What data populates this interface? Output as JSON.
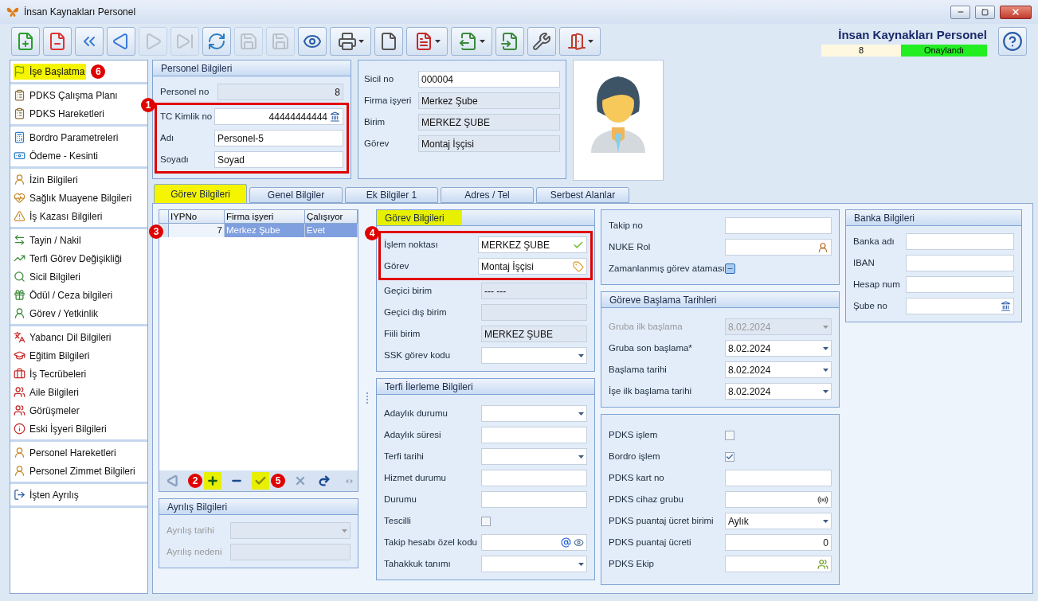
{
  "window": {
    "title": "İnsan Kaynakları Personel"
  },
  "toolbar": [
    {
      "kind": "new",
      "disabled": false,
      "menu": false
    },
    {
      "kind": "delete",
      "disabled": false,
      "menu": false
    },
    {
      "kind": "first",
      "disabled": false,
      "menu": false
    },
    {
      "kind": "prev",
      "disabled": false,
      "menu": false
    },
    {
      "kind": "next",
      "disabled": true,
      "menu": false
    },
    {
      "kind": "last",
      "disabled": true,
      "menu": false
    },
    {
      "kind": "refresh",
      "disabled": false,
      "menu": false
    },
    {
      "kind": "save",
      "disabled": true,
      "menu": false
    },
    {
      "kind": "discard",
      "disabled": true,
      "menu": false
    },
    {
      "kind": "preview",
      "disabled": false,
      "menu": false
    },
    {
      "kind": "print",
      "disabled": false,
      "menu": true
    },
    {
      "kind": "attach",
      "disabled": false,
      "menu": false
    },
    {
      "kind": "pdf",
      "disabled": false,
      "menu": true
    },
    {
      "kind": "export",
      "disabled": false,
      "menu": true
    },
    {
      "kind": "import",
      "disabled": false,
      "menu": false
    },
    {
      "kind": "tools",
      "disabled": false,
      "menu": false
    },
    {
      "kind": "exit",
      "disabled": false,
      "menu": true
    }
  ],
  "header": {
    "title": "İnsan Kaynakları Personel",
    "record_no": "8",
    "status": "Onaylandı"
  },
  "sidebar": {
    "groups": [
      [
        {
          "label": "İşe Başlatma",
          "highlighted": true,
          "badge": "6"
        }
      ],
      [
        {
          "label": "PDKS Çalışma Planı",
          "highlighted": false
        },
        {
          "label": "PDKS Hareketleri",
          "highlighted": false
        }
      ],
      [
        {
          "label": "Bordro Parametreleri",
          "highlighted": false
        },
        {
          "label": "Ödeme - Kesinti",
          "highlighted": false
        }
      ],
      [
        {
          "label": "İzin Bilgileri",
          "highlighted": false
        },
        {
          "label": "Sağlık Muayene Bilgileri",
          "highlighted": false
        },
        {
          "label": "İş Kazası Bilgileri",
          "highlighted": false
        }
      ],
      [
        {
          "label": "Tayin / Nakil",
          "highlighted": false
        },
        {
          "label": "Terfi Görev Değişikliği",
          "highlighted": false
        },
        {
          "label": "Sicil Bilgileri",
          "highlighted": false
        },
        {
          "label": "Ödül / Ceza bilgileri",
          "highlighted": false
        },
        {
          "label": "Görev / Yetkinlik",
          "highlighted": false
        }
      ],
      [
        {
          "label": "Yabancı Dil Bilgileri",
          "highlighted": false
        },
        {
          "label": "Eğitim Bilgileri",
          "highlighted": false
        },
        {
          "label": "İş Tecrübeleri",
          "highlighted": false
        },
        {
          "label": "Aile Bilgileri",
          "highlighted": false
        },
        {
          "label": "Görüşmeler",
          "highlighted": false
        },
        {
          "label": "Eski İşyeri Bilgileri",
          "highlighted": false
        }
      ],
      [
        {
          "label": "Personel Hareketleri",
          "highlighted": false
        },
        {
          "label": "Personel Zimmet Bilgileri",
          "highlighted": false
        }
      ],
      [
        {
          "label": "İşten Ayrılış",
          "highlighted": false
        }
      ]
    ]
  },
  "personnel": {
    "title": "Personel Bilgileri",
    "badge": "1",
    "groups": [
      {
        "framed": false,
        "fields": [
          {
            "label": "Personel no",
            "value": "8",
            "kind": "counter"
          }
        ]
      },
      {
        "framed": true,
        "fields": [
          {
            "label": "TC Kimlik no",
            "value": "44444444444",
            "kind": "bank"
          },
          {
            "label": "Adı",
            "value": "Personel-5",
            "kind": "text"
          },
          {
            "label": "Soyadı",
            "value": "Soyad",
            "kind": "text"
          }
        ]
      }
    ]
  },
  "registry": {
    "fields": [
      {
        "label": "Sicil no",
        "value": "000004",
        "kind": "text"
      },
      {
        "label": "Firma işyeri",
        "value": "Merkez Şube",
        "kind": "readonly"
      },
      {
        "label": "Birim",
        "value": "MERKEZ ŞUBE",
        "kind": "readonly"
      },
      {
        "label": "Görev",
        "value": "Montaj İşçisi",
        "kind": "readonly"
      }
    ]
  },
  "tabs": [
    {
      "label": "Görev Bilgileri",
      "selected": true,
      "highlighted": true
    },
    {
      "label": "Genel Bilgiler",
      "selected": false,
      "highlighted": false
    },
    {
      "label": "Ek Bilgiler 1",
      "selected": false,
      "highlighted": false
    },
    {
      "label": "Adres / Tel",
      "selected": false,
      "highlighted": false
    },
    {
      "label": "Serbest Alanlar",
      "selected": false,
      "highlighted": false
    }
  ],
  "grid": {
    "badge": "3",
    "columns": [
      "IYPNo",
      "Firma işyeri",
      "Çalışıyor"
    ],
    "rows": [
      {
        "cells": [
          "7",
          "Merkez Şube",
          "Evet"
        ],
        "selected": true
      }
    ],
    "navigator": [
      {
        "kind": "prev",
        "highlighted": false
      },
      {
        "kind": "add",
        "highlighted": true,
        "badge": "2"
      },
      {
        "kind": "remove",
        "highlighted": false
      },
      {
        "kind": "confirm",
        "highlighted": true,
        "badge": "5"
      },
      {
        "kind": "cancel",
        "highlighted": false
      },
      {
        "kind": "redo",
        "highlighted": false
      }
    ]
  },
  "leave": {
    "title": "Ayrılış Bilgileri",
    "fields": [
      {
        "label": "Ayrılış tarihi",
        "kind": "locked"
      },
      {
        "label": "Ayrılış nedeni",
        "kind": "inactive"
      }
    ]
  },
  "duty": {
    "title": "Görev Bilgileri",
    "title_highlighted": true,
    "badge": "4",
    "groups": [
      {
        "framed": true,
        "fields": [
          {
            "label": "İşlem noktası",
            "value": "MERKEZ ŞUBE",
            "kind": "approve"
          },
          {
            "label": "Görev",
            "value": "Montaj İşçisi",
            "kind": "tag"
          }
        ]
      },
      {
        "framed": false,
        "fields": [
          {
            "label": "Geçici birim",
            "value": "--- ---",
            "kind": "readonly"
          },
          {
            "label": "Geçici dış birim",
            "kind": "readonly"
          },
          {
            "label": "Fiili birim",
            "value": "MERKEZ ŞUBE",
            "kind": "readonly"
          },
          {
            "label": "SSK görev kodu",
            "kind": "dropdown"
          }
        ]
      }
    ]
  },
  "promotion": {
    "title": "Terfi İlerleme Bilgileri",
    "fields": [
      {
        "label": "Adaylık durumu",
        "kind": "dropdown"
      },
      {
        "label": "Adaylık süresi",
        "kind": "text"
      },
      {
        "label": "Terfi tarihi",
        "kind": "dropdown"
      },
      {
        "label": "Hizmet durumu",
        "kind": "text"
      },
      {
        "label": "Durumu",
        "kind": "text"
      },
      {
        "label": "Tescilli",
        "kind": "checkbox",
        "checked": false
      },
      {
        "label": "Takip hesabı özel kodu",
        "kind": "email"
      },
      {
        "label": "Tahakkuk tanımı",
        "kind": "dropdown"
      }
    ]
  },
  "tracking": {
    "fields": [
      {
        "label": "Takip no",
        "kind": "text"
      },
      {
        "label": "NUKE Rol",
        "kind": "person"
      },
      {
        "label": "Zamanlanmış görev ataması",
        "kind": "toggle"
      }
    ]
  },
  "start_dates": {
    "title": "Göreve Başlama Tarihleri",
    "fields": [
      {
        "label": "Gruba ilk başlama",
        "value": "8.02.2024",
        "kind": "locked"
      },
      {
        "label": "Gruba son başlama*",
        "value": "8.02.2024",
        "kind": "dropdown"
      },
      {
        "label": "Başlama tarihi",
        "value": "8.02.2024",
        "kind": "dropdown"
      },
      {
        "label": "İşe ilk başlama tarihi",
        "value": "8.02.2024",
        "kind": "dropdown"
      }
    ]
  },
  "pdks": {
    "fields": [
      {
        "label": "PDKS işlem",
        "kind": "checkbox",
        "checked": false
      },
      {
        "label": "Bordro işlem",
        "kind": "checkbox",
        "checked": true
      },
      {
        "label": "PDKS kart no",
        "kind": "text"
      },
      {
        "label": "PDKS cihaz grubu",
        "kind": "antenna"
      },
      {
        "label": "PDKS puantaj ücret birimi",
        "value": "Aylık",
        "kind": "dropdown"
      },
      {
        "label": "PDKS puantaj ücreti",
        "value": "0",
        "kind": "number"
      },
      {
        "label": "PDKS Ekip",
        "kind": "team"
      }
    ]
  },
  "bank": {
    "title": "Banka Bilgileri",
    "fields": [
      {
        "label": "Banka adı",
        "kind": "text"
      },
      {
        "label": "IBAN",
        "kind": "text"
      },
      {
        "label": "Hesap num",
        "kind": "text"
      },
      {
        "label": "Şube no",
        "kind": "bank"
      }
    ]
  }
}
